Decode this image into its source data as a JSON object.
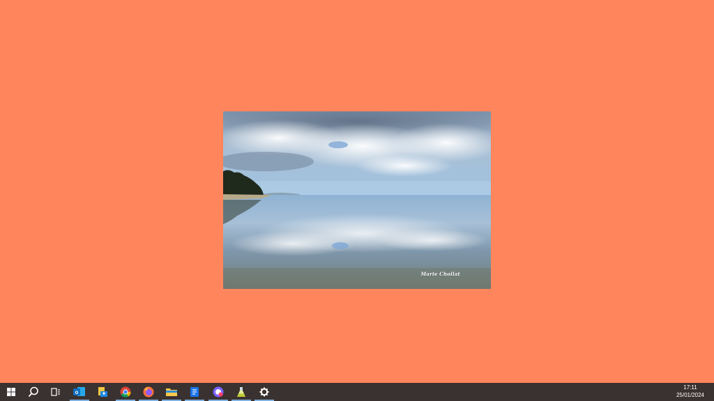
{
  "desktop": {
    "background_color": "#FF855C",
    "wallpaper_photo": {
      "watermark": "Marie Chollat"
    }
  },
  "taskbar": {
    "background_color": "#3A3230",
    "items": [
      {
        "name": "start-button",
        "icon": "windows-logo-icon"
      },
      {
        "name": "search-button",
        "icon": "search-icon"
      },
      {
        "name": "task-view-button",
        "icon": "task-view-icon"
      },
      {
        "name": "outlook-app",
        "icon": "outlook-icon"
      },
      {
        "name": "file-manager-app",
        "icon": "folder-user-icon"
      },
      {
        "name": "chrome-app",
        "icon": "chrome-icon"
      },
      {
        "name": "firefox-app",
        "icon": "firefox-icon"
      },
      {
        "name": "file-explorer-app",
        "icon": "file-explorer-icon"
      },
      {
        "name": "notepad-app",
        "icon": "document-icon"
      },
      {
        "name": "media-app",
        "icon": "media-icon"
      },
      {
        "name": "flask-app",
        "icon": "flask-icon"
      },
      {
        "name": "settings-app",
        "icon": "gear-icon"
      }
    ],
    "clock": {
      "time": "17:11",
      "date": "25/01/2024"
    }
  }
}
